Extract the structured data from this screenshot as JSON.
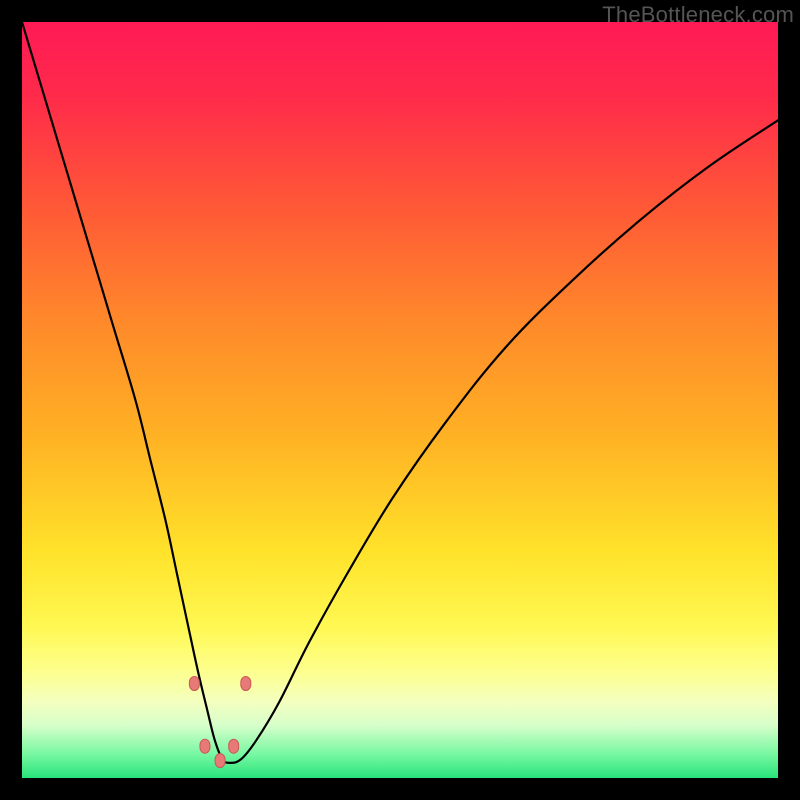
{
  "watermark": "TheBottleneck.com",
  "colors": {
    "gradient_stops": [
      {
        "offset": 0.0,
        "color": "#ff1a55"
      },
      {
        "offset": 0.1,
        "color": "#ff2b4a"
      },
      {
        "offset": 0.25,
        "color": "#ff5a36"
      },
      {
        "offset": 0.4,
        "color": "#ff8a2a"
      },
      {
        "offset": 0.55,
        "color": "#ffb224"
      },
      {
        "offset": 0.7,
        "color": "#ffe22a"
      },
      {
        "offset": 0.8,
        "color": "#fff852"
      },
      {
        "offset": 0.86,
        "color": "#fdff8f"
      },
      {
        "offset": 0.9,
        "color": "#f3ffc0"
      },
      {
        "offset": 0.93,
        "color": "#d7ffca"
      },
      {
        "offset": 0.97,
        "color": "#74f7a0"
      },
      {
        "offset": 1.0,
        "color": "#27e37c"
      }
    ],
    "curve": "#000000",
    "marker_fill": "#e77a77",
    "marker_stroke": "#c95a56"
  },
  "chart_data": {
    "type": "line",
    "title": "",
    "xlabel": "",
    "ylabel": "",
    "xlim": [
      0,
      100
    ],
    "ylim": [
      0,
      100
    ],
    "series": [
      {
        "name": "bottleneck-curve",
        "x": [
          0,
          3,
          6,
          9,
          12,
          15,
          17,
          19,
          20.5,
          22,
          23.3,
          24.5,
          25.5,
          26.5,
          27.5,
          29,
          31,
          34,
          38,
          43,
          49,
          56,
          64,
          73,
          82,
          91,
          100
        ],
        "y": [
          100,
          90,
          80,
          70,
          60,
          50,
          42,
          34,
          27,
          20,
          14,
          9,
          5,
          2.5,
          2,
          2.5,
          5,
          10,
          18,
          27,
          37,
          47,
          57,
          66,
          74,
          81,
          87
        ]
      }
    ],
    "markers": [
      {
        "x": 22.8,
        "y": 12.5
      },
      {
        "x": 24.2,
        "y": 4.2
      },
      {
        "x": 26.2,
        "y": 2.3
      },
      {
        "x": 28.0,
        "y": 4.2
      },
      {
        "x": 29.6,
        "y": 12.5
      }
    ]
  }
}
